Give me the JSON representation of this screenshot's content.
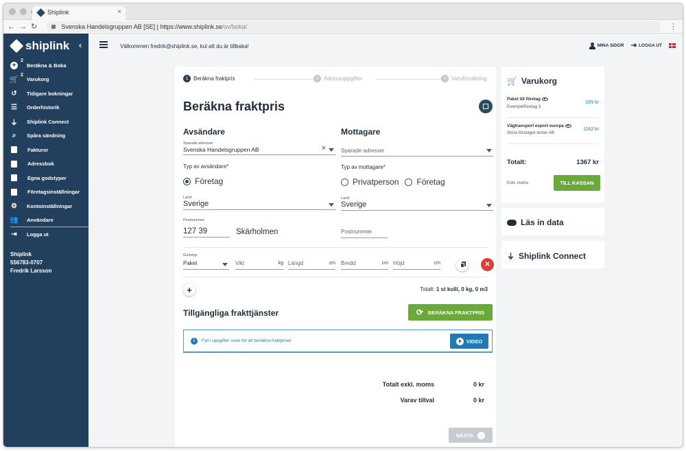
{
  "browser": {
    "tab_title": "Shiplink",
    "site_identity": "Svenska Handelsgruppen AB [SE]",
    "url_host": "https://www.shiplink.se",
    "url_path": "/sv/boka/"
  },
  "sidebar": {
    "logo": "shiplink",
    "items": [
      {
        "label": "Beräkna & Boka",
        "badge": "2",
        "icon": "plus-circle-icon"
      },
      {
        "label": "Varukorg",
        "badge": "2",
        "icon": "cart-icon"
      },
      {
        "label": "Tidigare bokningar",
        "badge": "",
        "icon": "history-icon"
      },
      {
        "label": "Orderhistorik",
        "badge": "",
        "icon": "list-icon"
      },
      {
        "label": "Shiplink Connect",
        "badge": "",
        "icon": "plug-icon"
      },
      {
        "label": "Spåra sändning",
        "badge": "",
        "icon": "search-icon"
      },
      {
        "label": "Fakturor",
        "badge": "",
        "icon": "invoice-icon"
      },
      {
        "label": "Adressbok",
        "badge": "",
        "icon": "address-book-icon"
      },
      {
        "label": "Egna godstyper",
        "badge": "",
        "icon": "box-icon"
      },
      {
        "label": "Företagsinställningar",
        "badge": "",
        "icon": "building-icon"
      },
      {
        "label": "Kontoinställningar",
        "badge": "",
        "icon": "gear-icon"
      },
      {
        "label": "Användare",
        "badge": "",
        "icon": "users-icon"
      },
      {
        "label": "Logga ut",
        "badge": "",
        "icon": "logout-icon"
      }
    ],
    "account": {
      "company": "Shiplink",
      "number": "556783-0707",
      "user": "Fredrik Larsson"
    }
  },
  "topbar": {
    "welcome": "Välkommen fredrik@shiplink.se, kul att du är tillbaka!",
    "my_pages": "MINA SIDOR",
    "logout": "LOGGA UT"
  },
  "steps": [
    {
      "num": "1",
      "label": "Beräkna fraktpris",
      "active": true
    },
    {
      "num": "2",
      "label": "Adressuppgifter",
      "active": false
    },
    {
      "num": "3",
      "label": "Varuförsäkring",
      "active": false
    }
  ],
  "form": {
    "title": "Beräkna fraktpris",
    "sender": {
      "heading": "Avsändare",
      "saved_label": "Sparade adresser",
      "saved_value": "Svenska Handelsgruppen AB",
      "type_label": "Typ av avsändare*",
      "type_option": "Företag",
      "country_label": "Land",
      "country_value": "Sverige",
      "postal_label": "Postnummer",
      "postal_value": "127 39",
      "city": "Skärholmen"
    },
    "receiver": {
      "heading": "Mottagare",
      "saved_placeholder": "Sparade adresser",
      "type_label": "Typ av mottagare*",
      "option_private": "Privatperson",
      "option_company": "Företag",
      "country_label": "Land",
      "country_value": "Sverige",
      "postal_placeholder": "Postnummer"
    },
    "goods": {
      "type_label": "Godstyp",
      "type_value": "Paket",
      "weight_placeholder": "Vikt",
      "weight_unit": "kg",
      "length_placeholder": "Längd",
      "length_unit": "cm",
      "width_placeholder": "Bredd",
      "width_unit": "cm",
      "height_placeholder": "Höjd",
      "height_unit": "cm"
    },
    "total_prefix": "Totalt:",
    "total_value": "1 st kolli, 0 kg, 0 m3"
  },
  "services": {
    "heading": "Tillgängliga frakttjänster",
    "calc_button": "BERÄKNA FRAKTPRIS",
    "info_text": "Fyll i uppgifter ovan för att beräkna fraktpriser",
    "video_button": "VIDEO",
    "total_excl_label": "Totalt exkl. moms",
    "total_excl_value": "0 kr",
    "addon_label": "Varav tillval",
    "addon_value": "0 kr",
    "next_button": "NÄSTA"
  },
  "cart": {
    "heading": "Varukorg",
    "items": [
      {
        "name": "Paket till företag",
        "sub": "Exempelföretag 3",
        "price": "205 kr"
      },
      {
        "name": "Vägtransport export europa",
        "sub": "Stora företaget testar AB",
        "price": "1162 kr"
      }
    ],
    "total_label": "Totalt:",
    "total_value": "1367 kr",
    "vat_label": "Exkl. moms",
    "checkout": "TILL KASSAN"
  },
  "load_data": "Läs in data",
  "connect": "Shiplink Connect"
}
